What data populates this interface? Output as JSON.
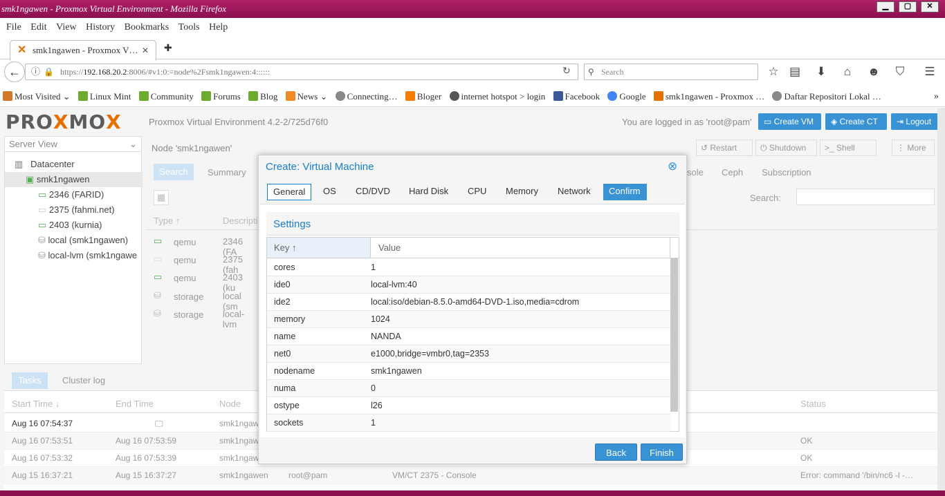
{
  "window": {
    "title": "smk1ngawen - Proxmox Virtual Environment - Mozilla Firefox",
    "min": "▁",
    "max": "▢",
    "close": "✕"
  },
  "menu": [
    "File",
    "Edit",
    "View",
    "History",
    "Bookmarks",
    "Tools",
    "Help"
  ],
  "tab": {
    "title": "smk1ngawen - Proxmox V…",
    "close": "✕",
    "new": "✚"
  },
  "nav": {
    "url_prefix": "https://",
    "url_host": "192.168.20.2",
    "url_rest": ":8006/#v1:0:=node%2Fsmk1ngawen:4::::::",
    "search_placeholder": "Search"
  },
  "bookmarks": [
    {
      "label": "Most Visited ⌄",
      "color": "#d07a2a"
    },
    {
      "label": "Linux Mint",
      "color": "#6cab2e"
    },
    {
      "label": "Community",
      "color": "#6cab2e"
    },
    {
      "label": "Forums",
      "color": "#6cab2e"
    },
    {
      "label": "Blog",
      "color": "#6cab2e"
    },
    {
      "label": "News ⌄",
      "color": "#f08a24"
    },
    {
      "label": "Connecting…",
      "color": "#888888"
    },
    {
      "label": "Bloger",
      "color": "#f57d00"
    },
    {
      "label": "internet hotspot > login",
      "color": "#555555"
    },
    {
      "label": "Facebook",
      "color": "#3b5998"
    },
    {
      "label": "Google",
      "color": "#4285f4"
    },
    {
      "label": "smk1ngawen - Proxmox …",
      "color": "#e57000"
    },
    {
      "label": "Daftar Repositori Lokal …",
      "color": "#888888"
    }
  ],
  "header": {
    "logo_a": "PRO",
    "logo_x": "X",
    "logo_b": "MO",
    "logo_x2": "X",
    "version": "Proxmox Virtual Environment 4.2-2/725d76f0",
    "login": "You are logged in as 'root@pam'",
    "create_vm": "Create VM",
    "create_ct": "Create CT",
    "logout": "Logout"
  },
  "tree": {
    "view": "Server View",
    "items": [
      "Datacenter",
      "smk1ngawen",
      "2346 (FARID)",
      "2375 (fahmi.net)",
      "2403 (kurnia)",
      "local (smk1ngawen)",
      "local-lvm (smk1ngawe"
    ]
  },
  "node": {
    "title": "Node 'smk1ngawen'",
    "actions": [
      "Restart",
      "Shutdown",
      "Shell",
      "More"
    ],
    "tabs": [
      "Search",
      "Summary",
      "sole",
      "Ceph",
      "Subscription"
    ],
    "search_label": "Search:",
    "cols": [
      "Type ↑",
      "Descripti"
    ],
    "rows": [
      {
        "type": "qemu",
        "desc": "2346 (FA"
      },
      {
        "type": "qemu",
        "desc": "2375 (fah"
      },
      {
        "type": "qemu",
        "desc": "2403 (ku"
      },
      {
        "type": "storage",
        "desc": "local (sm"
      },
      {
        "type": "storage",
        "desc": "local-lvm"
      }
    ]
  },
  "tasks": {
    "tabs": [
      "Tasks",
      "Cluster log"
    ],
    "cols": [
      "Start Time ↓",
      "End Time",
      "Node",
      "Status"
    ],
    "rows": [
      {
        "start": "Aug 16 07:54:37",
        "end": "",
        "node": "smk1ngaw",
        "user": "",
        "desc": "",
        "status": ""
      },
      {
        "start": "Aug 16 07:53:51",
        "end": "Aug 16 07:53:59",
        "node": "smk1ngaw",
        "user": "",
        "desc": "",
        "status": "OK"
      },
      {
        "start": "Aug 16 07:53:32",
        "end": "Aug 16 07:53:39",
        "node": "smk1ngaw",
        "user": "",
        "desc": "",
        "status": "OK"
      },
      {
        "start": "Aug 15 16:37:21",
        "end": "Aug 15 16:37:27",
        "node": "smk1ngawen",
        "user": "root@pam",
        "desc": "VM/CT 2375 - Console",
        "status": "Error: command '/bin/nc6 -l -…"
      }
    ]
  },
  "dialog": {
    "title": "Create: Virtual Machine",
    "tabs": [
      "General",
      "OS",
      "CD/DVD",
      "Hard Disk",
      "CPU",
      "Memory",
      "Network",
      "Confirm"
    ],
    "section": "Settings",
    "col_key": "Key ↑",
    "col_value": "Value",
    "rows": [
      {
        "k": "cores",
        "v": "1"
      },
      {
        "k": "ide0",
        "v": "local-lvm:40"
      },
      {
        "k": "ide2",
        "v": "local:iso/debian-8.5.0-amd64-DVD-1.iso,media=cdrom"
      },
      {
        "k": "memory",
        "v": "1024"
      },
      {
        "k": "name",
        "v": "NANDA"
      },
      {
        "k": "net0",
        "v": "e1000,bridge=vmbr0,tag=2353"
      },
      {
        "k": "nodename",
        "v": "smk1ngawen"
      },
      {
        "k": "numa",
        "v": "0"
      },
      {
        "k": "ostype",
        "v": "l26"
      },
      {
        "k": "sockets",
        "v": "1"
      }
    ],
    "back": "Back",
    "finish": "Finish",
    "close": "⊗"
  }
}
